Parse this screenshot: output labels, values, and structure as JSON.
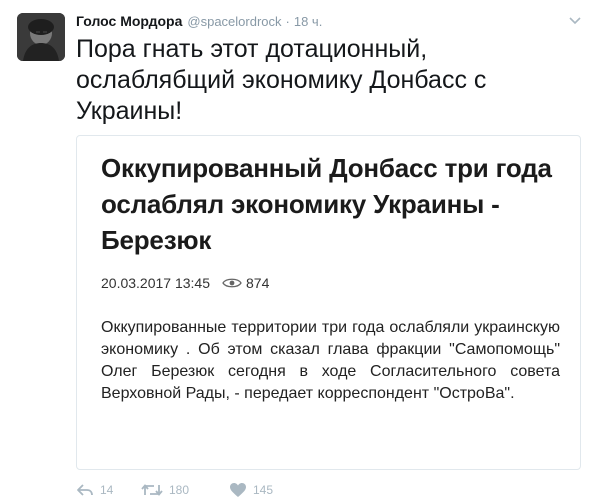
{
  "tweet": {
    "author_name": "Голос Мордора",
    "author_handle": "@spacelordrock",
    "separator": "·",
    "timestamp": "18 ч.",
    "text": "Пора гнать этот дотационный, ослаблябщий экономику Донбасс с Украины!"
  },
  "card": {
    "title": "Оккупированный Донбасс три года ослаблял экономику Украины - Березюк",
    "date": "20.03.2017 13:45",
    "views": "874",
    "body": "Оккупированные территории три года ослабляли украинскую экономику . Об этом сказал глава фракции \"Самопомощь\" Олег Березюк сегодня в ходе Согласительного совета Верховной Рады, - передает корреспондент \"ОстроВа\"."
  },
  "actions": {
    "reply_count": "14",
    "retweet_count": "180",
    "like_count": "145"
  },
  "icons": [
    "reply-icon",
    "retweet-icon",
    "heart-icon",
    "eye-icon",
    "chevron-down-icon"
  ],
  "colors": {
    "muted_text": "#8899a6",
    "action_icon": "#aab8c2",
    "card_border": "#e1e8ed"
  }
}
